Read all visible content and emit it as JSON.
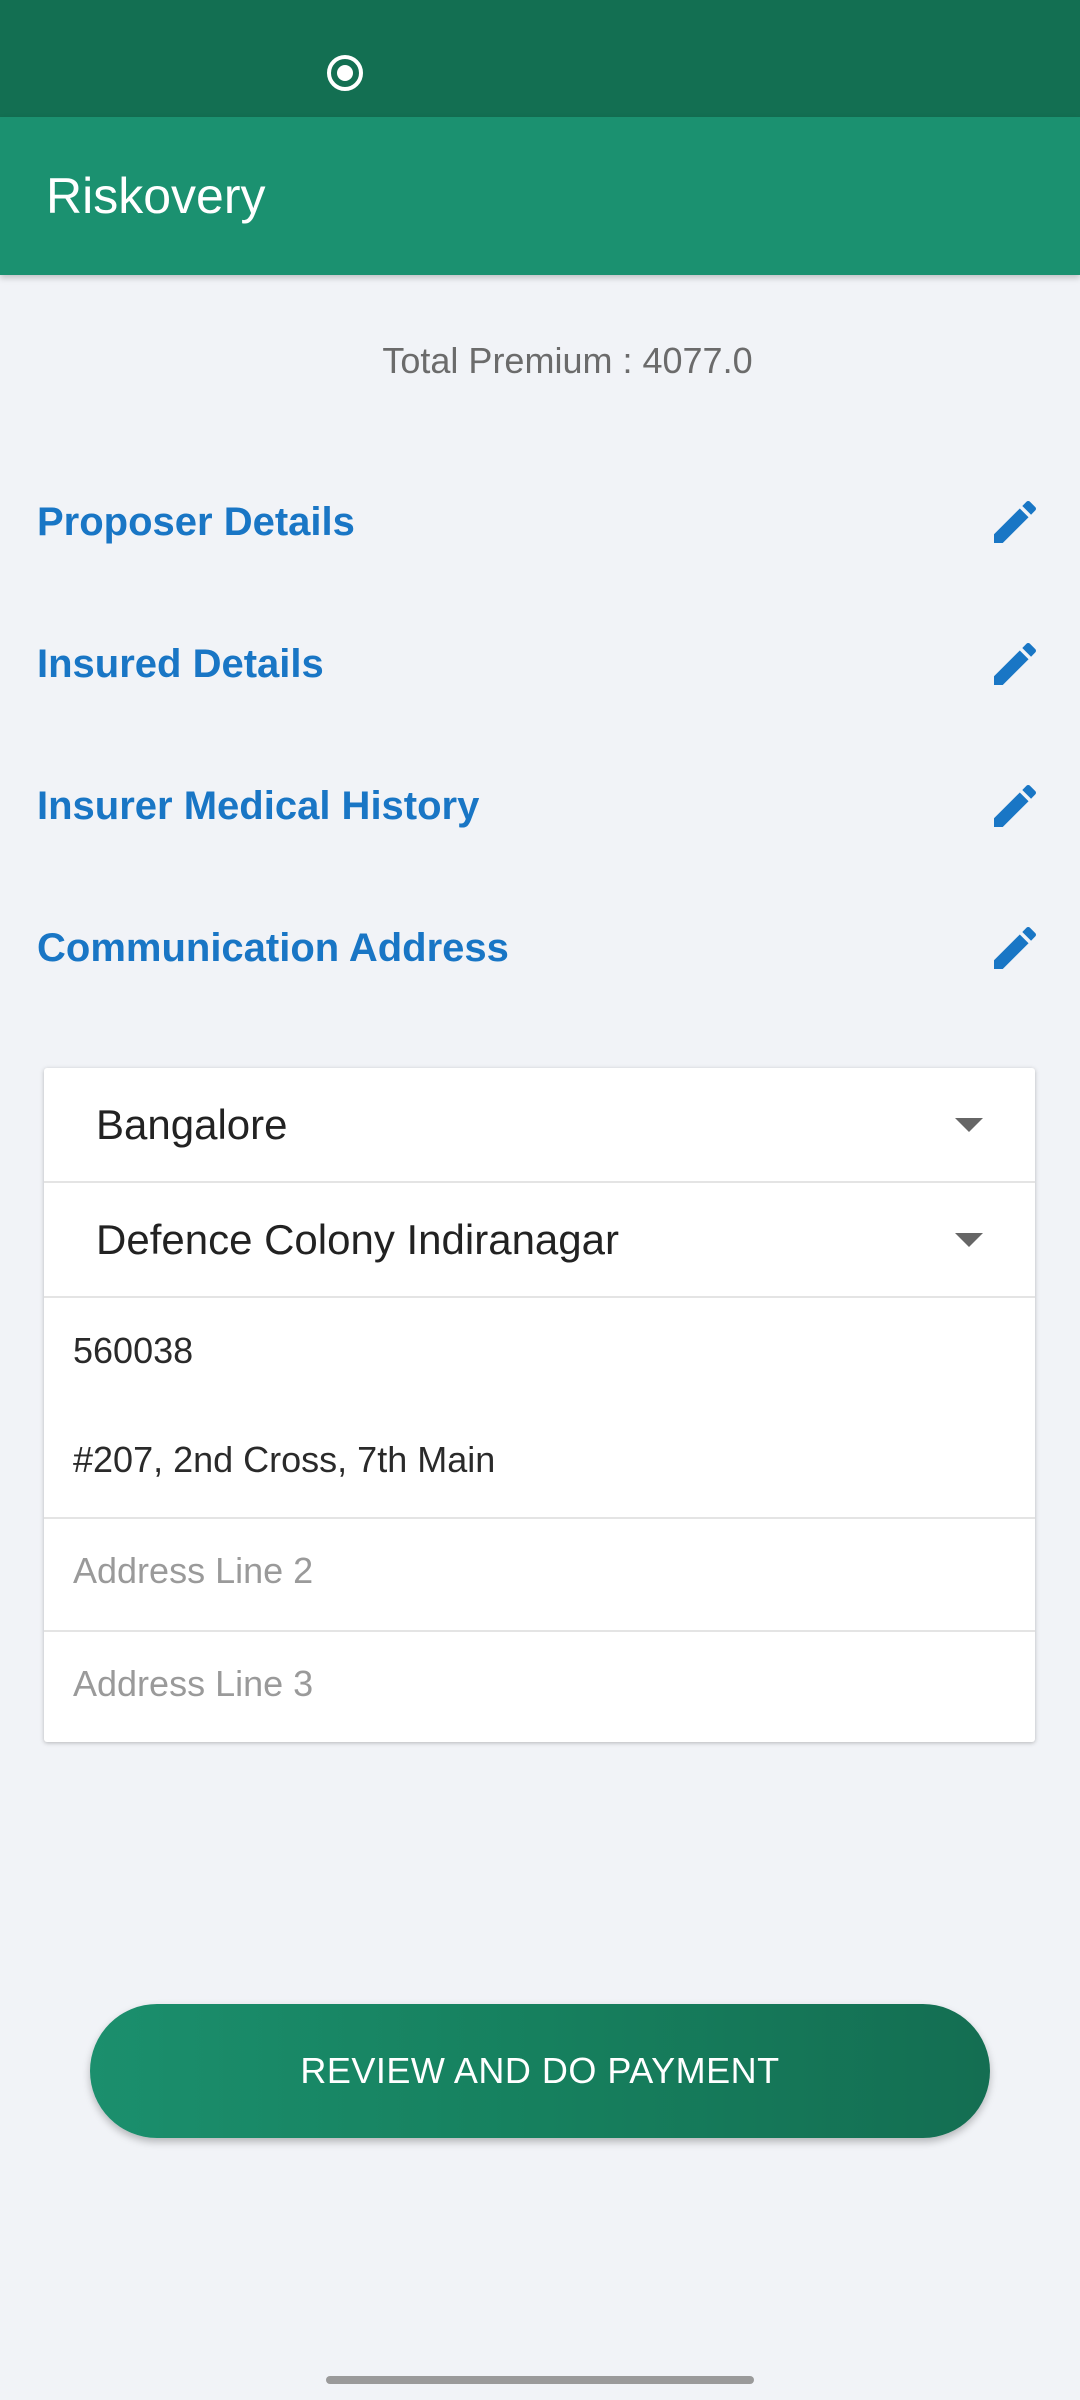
{
  "app": {
    "title": "Riskovery"
  },
  "premium": {
    "label": "Total Premium :",
    "value": "4077.0"
  },
  "sections": [
    {
      "label": "Proposer Details",
      "icon": "edit-pencil-icon"
    },
    {
      "label": "Insured Details",
      "icon": "edit-pencil-icon"
    },
    {
      "label": "Insurer Medical History",
      "icon": "edit-pencil-icon"
    },
    {
      "label": "Communication Address",
      "icon": "edit-pencil-icon"
    }
  ],
  "address": {
    "city": "Bangalore",
    "area": "Defence Colony Indiranagar",
    "pincode": "560038",
    "line1": "#207, 2nd Cross, 7th Main",
    "line2_placeholder": "Address Line 2",
    "line3_placeholder": "Address Line 3"
  },
  "actions": {
    "pay_label": "REVIEW AND DO PAYMENT"
  },
  "colors": {
    "status_bar": "#136f52",
    "app_bar": "#1b9170",
    "section_link": "#1976c5",
    "background": "#f1f3f7"
  }
}
